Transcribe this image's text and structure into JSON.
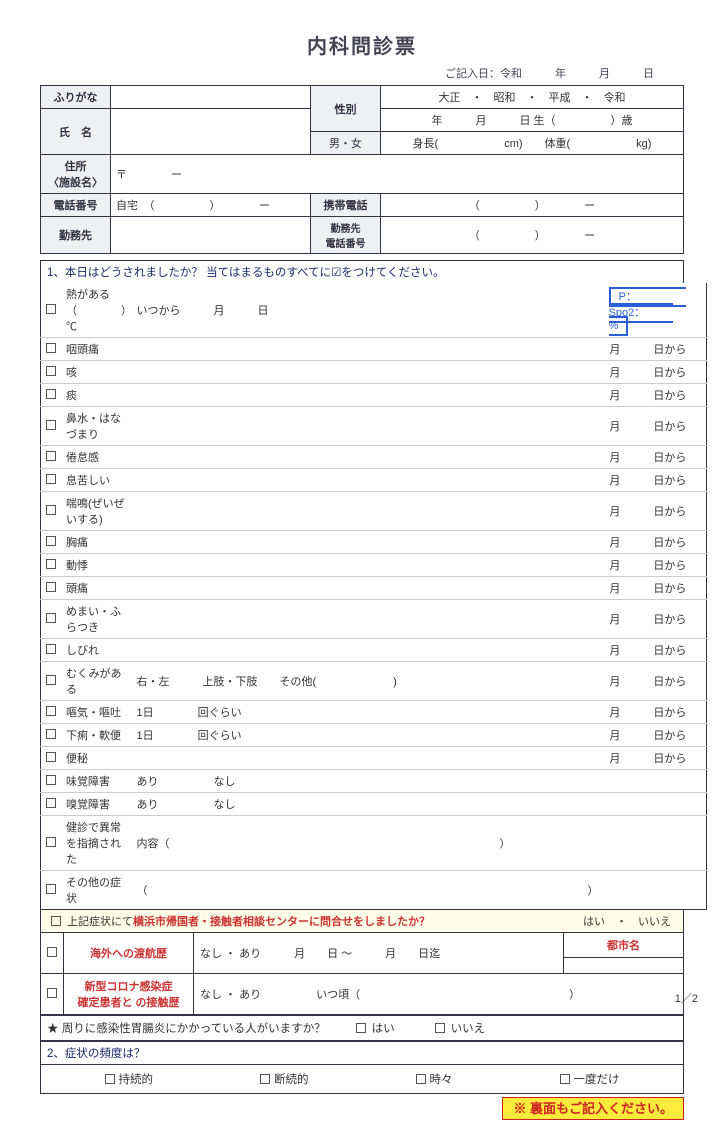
{
  "title": "内科問診票",
  "entry_date": "ご記入日：令和　　　年　　　月　　　日",
  "info": {
    "furigana_label": "ふりがな",
    "name_label": "氏　名",
    "gender_label": "性別",
    "gender_opts": "男・女",
    "era_line": "大正　・　昭和　・　平成　・　令和",
    "dob_line": "年　　　月　　　日 生（　　　　　）歳",
    "height_weight": "身長(　　　　　　cm)　　体重(　　　　　　kg)",
    "address_label": "住所\n〈施設名〉",
    "address_value": "〒　　　　ー",
    "phone_label": "電話番号",
    "phone_home": "自宅　（　　　　　）　　　　ー",
    "mobile_label": "携帯電話",
    "mobile_val": "（　　　　　）　　　　ー",
    "work_label": "勤務先",
    "work_phone_label": "勤務先\n電話番号",
    "work_phone_val": "（　　　　　）　　　　ー"
  },
  "q1_head": "1、本日はどうされましたか？ 当てはまるものすべてに☑をつけてください。",
  "symptoms": [
    {
      "label": "熱がある　（　　　　）℃",
      "extra": "いつから　　　月　　　日",
      "date": "",
      "vital": "P：　　　　　Spo2：　　　%"
    },
    {
      "label": "咽頭痛",
      "date": "月　　　日から"
    },
    {
      "label": "咳",
      "date": "月　　　日から"
    },
    {
      "label": "痰",
      "date": "月　　　日から"
    },
    {
      "label": "鼻水・はなづまり",
      "date": "月　　　日から"
    },
    {
      "label": "倦怠感",
      "date": "月　　　日から"
    },
    {
      "label": "息苦しい",
      "date": "月　　　日から"
    },
    {
      "label": "喘鳴(ぜいぜいする)",
      "date": "月　　　日から"
    },
    {
      "label": "胸痛",
      "date": "月　　　日から"
    },
    {
      "label": "動悸",
      "date": "月　　　日から"
    },
    {
      "label": "頭痛",
      "date": "月　　　日から"
    },
    {
      "label": "めまい・ふらつき",
      "date": "月　　　日から"
    },
    {
      "label": "しびれ",
      "date": "月　　　日から"
    },
    {
      "label": "むくみがある",
      "extra": "右・左　　　上肢・下肢　　その他(　　　　　　　)",
      "date": "月　　　日から"
    },
    {
      "label": "嘔気・嘔吐",
      "extra": "1日　　　　回ぐらい",
      "date": "月　　　日から"
    },
    {
      "label": "下痢・軟便",
      "extra": "1日　　　　回ぐらい",
      "date": "月　　　日から"
    },
    {
      "label": "便秘",
      "date": "月　　　日から"
    },
    {
      "label": "味覚障害",
      "extra": "あり　　　　　なし",
      "date": ""
    },
    {
      "label": "嗅覚障害",
      "extra": "あり　　　　　なし",
      "date": ""
    },
    {
      "label": "健診で異常を指摘された",
      "extra": "内容（　　　　　　　　　　　　　　　　　　　　　　　　　　　　　　）",
      "date": ""
    },
    {
      "label": "その他の症状",
      "extra": "（　　　　　　　　　　　　　　　　　　　　　　　　　　　　　　　　　　　　　　　　）",
      "date": ""
    }
  ],
  "q1b": {
    "text_a": "上記症状にて",
    "text_b": "横浜市帰国者・接触者相談センターに問合せをしましたか？",
    "opts": "はい　・　いいえ"
  },
  "travel": {
    "overseas_label": "海外への渡航歴",
    "overseas_val": "なし ・ あり　　　月　　日 ～　　　月　　日迄",
    "city_label": "都市名",
    "covid_label1": "新型コロナ感染症",
    "covid_label2": "確定患者と の接触歴",
    "covid_val": "なし ・ あり　　　　　いつ頃（　　　　　　　　　　　　　　　　　　　）"
  },
  "star_q": "★ 周りに感染性胃腸炎にかかっている人がいますか？",
  "star_yes": "はい",
  "star_no": "いいえ",
  "q2_head": "2、症状の頻度は？",
  "q2_opts": [
    "持続的",
    "断続的",
    "時々",
    "一度だけ"
  ],
  "footer_note": "※ 裏面もご記入ください。",
  "page_num": "1／2"
}
